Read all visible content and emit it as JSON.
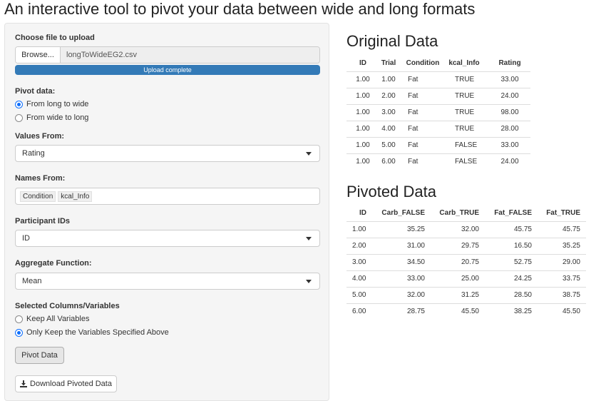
{
  "title": "An interactive tool to pivot your data between wide and long formats",
  "sidebar": {
    "file_label": "Choose file to upload",
    "browse_label": "Browse...",
    "file_name": "longToWideEG2.csv",
    "progress_text": "Upload complete",
    "progress": 1.0,
    "pivot_label": "Pivot data:",
    "pivot_options": [
      "From long to wide",
      "From wide to long"
    ],
    "pivot_selected": 0,
    "values_from_label": "Values From:",
    "values_from_value": "Rating",
    "names_from_label": "Names From:",
    "names_from_tags": [
      "Condition",
      "kcal_Info"
    ],
    "participant_label": "Participant IDs",
    "participant_value": "ID",
    "aggregate_label": "Aggregate Function:",
    "aggregate_value": "Mean",
    "selected_label": "Selected Columns/Variables",
    "selected_options": [
      "Keep All Variables",
      "Only Keep the Variables Specified Above"
    ],
    "selected_selected": 1,
    "pivot_button": "Pivot Data",
    "download_button": "Download Pivoted Data"
  },
  "original": {
    "heading": "Original Data",
    "columns": [
      "ID",
      "Trial",
      "Condition",
      "kcal_Info",
      "Rating"
    ],
    "rows": [
      [
        "1.00",
        "1.00",
        "Fat",
        "TRUE",
        "33.00"
      ],
      [
        "1.00",
        "2.00",
        "Fat",
        "TRUE",
        "24.00"
      ],
      [
        "1.00",
        "3.00",
        "Fat",
        "TRUE",
        "98.00"
      ],
      [
        "1.00",
        "4.00",
        "Fat",
        "TRUE",
        "28.00"
      ],
      [
        "1.00",
        "5.00",
        "Fat",
        "FALSE",
        "33.00"
      ],
      [
        "1.00",
        "6.00",
        "Fat",
        "FALSE",
        "24.00"
      ]
    ]
  },
  "pivoted": {
    "heading": "Pivoted Data",
    "columns": [
      "ID",
      "Carb_FALSE",
      "Carb_TRUE",
      "Fat_FALSE",
      "Fat_TRUE"
    ],
    "rows": [
      [
        "1.00",
        "35.25",
        "32.00",
        "45.75",
        "45.75"
      ],
      [
        "2.00",
        "31.00",
        "29.75",
        "16.50",
        "35.25"
      ],
      [
        "3.00",
        "34.50",
        "20.75",
        "52.75",
        "29.00"
      ],
      [
        "4.00",
        "33.00",
        "25.00",
        "24.25",
        "33.75"
      ],
      [
        "5.00",
        "32.00",
        "31.25",
        "28.50",
        "38.75"
      ],
      [
        "6.00",
        "28.75",
        "45.50",
        "38.25",
        "45.50"
      ]
    ]
  },
  "colors": {
    "accent": "#337ab7",
    "radio": "#0d6efd",
    "panel": "#f5f5f5"
  },
  "icons": {
    "download": "download-icon",
    "caret": "caret-down-icon"
  }
}
